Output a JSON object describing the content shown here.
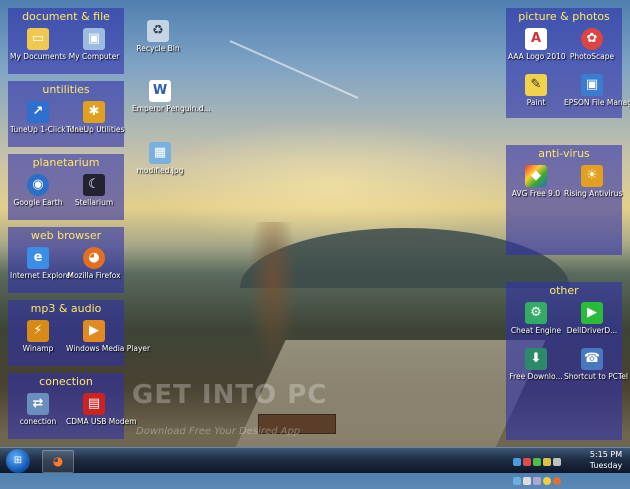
{
  "panels": {
    "document_file": {
      "title": "document & file",
      "icons": [
        {
          "label": "My Documents"
        },
        {
          "label": "My Computer"
        }
      ]
    },
    "utilities": {
      "title": "untilities",
      "icons": [
        {
          "label": "TuneUp 1-Click Mai..."
        },
        {
          "label": "TuneUp Utilities"
        }
      ]
    },
    "planetarium": {
      "title": "planetarium",
      "icons": [
        {
          "label": "Google Earth"
        },
        {
          "label": "Stellarium"
        }
      ]
    },
    "web_browser": {
      "title": "web browser",
      "icons": [
        {
          "label": "Internet Explorer"
        },
        {
          "label": "Mozilla Firefox"
        }
      ]
    },
    "mp3_audio": {
      "title": "mp3  &  audio",
      "icons": [
        {
          "label": "Winamp"
        },
        {
          "label": "Windows Media Player"
        }
      ]
    },
    "conection": {
      "title": "conection",
      "icons": [
        {
          "label": "conection"
        },
        {
          "label": "CDMA USB Modem"
        }
      ]
    },
    "picture_photos": {
      "title": "picture & photos",
      "icons": [
        {
          "label": "AAA Logo 2010"
        },
        {
          "label": "PhotoScape"
        },
        {
          "label": "Paint"
        },
        {
          "label": "EPSON File Manager"
        }
      ]
    },
    "anti_virus": {
      "title": "anti-virus",
      "icons": [
        {
          "label": "AVG Free 9.0"
        },
        {
          "label": "Rising Antivirus"
        }
      ]
    },
    "other": {
      "title": "other",
      "icons": [
        {
          "label": "Cheat Engine"
        },
        {
          "label": "DellDriverD..."
        },
        {
          "label": "Free Downlo..."
        },
        {
          "label": "Shortcut to PCTel"
        }
      ]
    }
  },
  "desktop": [
    {
      "label": "Recycle Bin"
    },
    {
      "label": "Emperor Penguin.d..."
    },
    {
      "label": "modified.jpg"
    }
  ],
  "watermark": {
    "title": "GET INTO PC",
    "subtitle": "Download Free Your Desired App"
  },
  "clock": {
    "time": "5:15 PM",
    "day": "Tuesday"
  },
  "colors": {
    "panel_bg": "#3030aa",
    "panel_title": "#ffe866",
    "taskbar": "#1d2c42"
  }
}
